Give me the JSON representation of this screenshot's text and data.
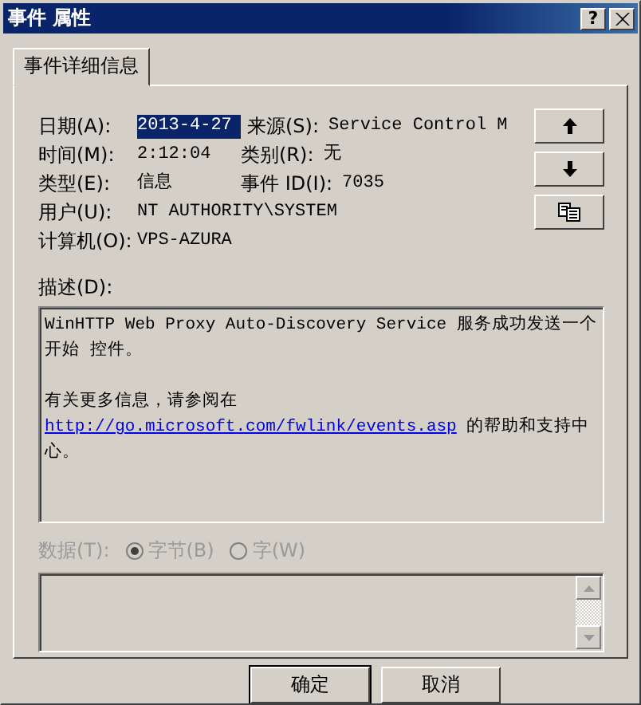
{
  "window": {
    "title": "事件 属性",
    "help": "?"
  },
  "tabs": [
    {
      "label": "事件详细信息",
      "selected": true
    }
  ],
  "rows": [
    {
      "fields": [
        {
          "label": "日期(A):",
          "value": "2013-4-27",
          "selected": true
        },
        {
          "label": "来源(S):",
          "value": "Service Control M",
          "selected": false
        }
      ]
    },
    {
      "fields": [
        {
          "label": "时间(M):",
          "value": "2:12:04",
          "selected": false
        },
        {
          "label": "类别(R):",
          "value": "无",
          "selected": false
        }
      ]
    },
    {
      "fields": [
        {
          "label": "类型(E):",
          "value": "信息",
          "selected": false
        },
        {
          "label": "事件 ID(I):",
          "value": "7035",
          "selected": false
        }
      ]
    },
    {
      "fields": [
        {
          "label": "用户(U):",
          "value": "NT AUTHORITY\\SYSTEM",
          "selected": false
        }
      ]
    },
    {
      "fields": [
        {
          "label": "计算机(O):",
          "value": "VPS-AZURA",
          "selected": false
        }
      ]
    }
  ],
  "description": {
    "label": "描述(D):",
    "paragraphs": [
      {
        "text": "WinHTTP Web Proxy Auto-Discovery Service 服务成功发送一个开始 控件。"
      },
      {
        "text": "有关更多信息，请参阅在",
        "link": "http://go.microsoft.com/fwlink/events.asp",
        "after": "的帮助和支持中心。"
      }
    ]
  },
  "data": {
    "label": "数据(T):",
    "disabled": true,
    "options": [
      {
        "label": "字节(B)",
        "selected": true
      },
      {
        "label": "字(W)",
        "selected": false
      }
    ]
  },
  "buttons": [
    {
      "label": "确定",
      "default": true
    },
    {
      "label": "取消",
      "default": false
    }
  ]
}
